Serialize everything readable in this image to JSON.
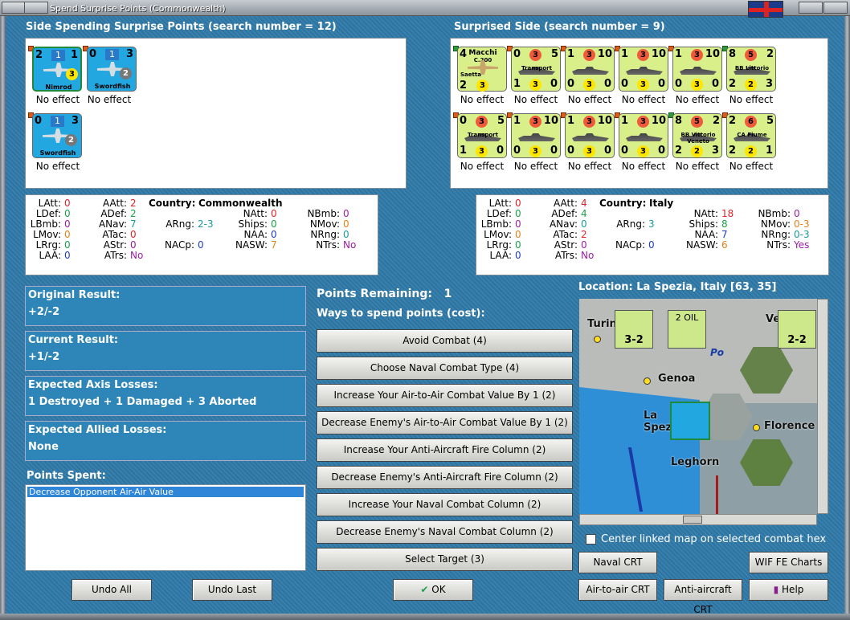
{
  "window": {
    "title": "Spend Surprise Points (Commonwealth)"
  },
  "left_header": "Side Spending Surprise Points (search number = 12)",
  "right_header": "Surprised Side (search number = 9)",
  "left_units": [
    {
      "name": "Nimrod",
      "tl": "2",
      "tr": "1",
      "mid": "1",
      "circ": "3",
      "effect": "No effect"
    },
    {
      "name": "Swordfish",
      "tl": "0",
      "tr": "3",
      "mid": "1",
      "circ": "2",
      "effect": "No effect"
    },
    {
      "name": "Swordfish",
      "tl": "0",
      "tr": "3",
      "mid": "1",
      "circ": "2",
      "effect": "No effect"
    }
  ],
  "right_units": [
    {
      "name": "Macchi",
      "sub": "C.200",
      "sub2": "Saetta",
      "tl": "4",
      "bl": "2",
      "circ": "3",
      "effect": "No effect"
    },
    {
      "name": "Transport",
      "tl": "0",
      "c": "3",
      "tr": "5",
      "bl": "1",
      "bc": "3",
      "br": "0",
      "effect": "No effect"
    },
    {
      "name": "",
      "tl": "1",
      "c": "3",
      "tr": "10",
      "bl": "0",
      "bc": "3",
      "br": "0",
      "effect": "No effect"
    },
    {
      "name": "",
      "tl": "1",
      "c": "3",
      "tr": "10",
      "bl": "0",
      "bc": "3",
      "br": "0",
      "effect": "No effect"
    },
    {
      "name": "",
      "tl": "1",
      "c": "3",
      "tr": "10",
      "bl": "0",
      "bc": "3",
      "br": "0",
      "effect": "No effect"
    },
    {
      "name": "BB Littorio",
      "tl": "8",
      "c": "5",
      "tr": "2",
      "bl": "2",
      "bc": "2",
      "br": "3",
      "effect": "No effect"
    },
    {
      "name": "Transport",
      "tl": "0",
      "c": "3",
      "tr": "5",
      "bl": "1",
      "bc": "3",
      "br": "0",
      "effect": "No effect"
    },
    {
      "name": "",
      "tl": "1",
      "c": "3",
      "tr": "10",
      "bl": "0",
      "bc": "3",
      "br": "0",
      "effect": "No effect"
    },
    {
      "name": "",
      "tl": "1",
      "c": "3",
      "tr": "10",
      "bl": "0",
      "bc": "3",
      "br": "0",
      "effect": "No effect"
    },
    {
      "name": "",
      "tl": "1",
      "c": "3",
      "tr": "10",
      "bl": "0",
      "bc": "3",
      "br": "0",
      "effect": "No effect"
    },
    {
      "name": "BB Vittorio Veneto",
      "tl": "8",
      "c": "5",
      "tr": "2",
      "bl": "2",
      "bc": "2",
      "br": "3",
      "effect": "No effect"
    },
    {
      "name": "CA Fiume",
      "tl": "2",
      "c": "6",
      "tr": "5",
      "bl": "2",
      "bc": "2",
      "br": "1",
      "effect": "No effect"
    }
  ],
  "left_stats": {
    "country_label": "Country:",
    "country": "Commonwealth",
    "LAtt": "0",
    "LDef": "0",
    "LBmb": "0",
    "LMov": "0",
    "LRrg": "0",
    "LAA": "0",
    "AAtt": "2",
    "ADef": "2",
    "ANav": "7",
    "ATac": "0",
    "AStr": "0",
    "ATrs": "No",
    "ARng": "2-3",
    "NACp": "0",
    "NAtt": "0",
    "Ships": "0",
    "NAA": "0",
    "NASW": "7",
    "NBmb": "0",
    "NMov": "0",
    "NRng": "0",
    "NTrs": "No"
  },
  "right_stats": {
    "country_label": "Country:",
    "country": "Italy",
    "LAtt": "0",
    "LDef": "0",
    "LBmb": "0",
    "LMov": "0",
    "LRrg": "0",
    "LAA": "0",
    "AAtt": "4",
    "ADef": "4",
    "ANav": "0",
    "ATac": "2",
    "AStr": "0",
    "ATrs": "No",
    "ARng": "3",
    "NACp": "0",
    "NAtt": "18",
    "Ships": "8",
    "NAA": "7",
    "NASW": "6",
    "NBmb": "0",
    "NMov": "0-3",
    "NRng": "0-3",
    "NTrs": "Yes"
  },
  "results": {
    "original_label": "Original Result:",
    "original": "+2/-2",
    "current_label": "Current Result:",
    "current": "+1/-2",
    "axis_label": "Expected Axis Losses:",
    "axis": "1 Destroyed + 1 Damaged + 3 Aborted",
    "allied_label": "Expected Allied Losses:",
    "allied": "None"
  },
  "points_spent_label": "Points Spent:",
  "points_spent_items": [
    "Decrease Opponent Air-Air Value"
  ],
  "points_remaining_label": "Points Remaining:",
  "points_remaining": "1",
  "ways_label": "Ways to spend points (cost):",
  "options": [
    "Avoid Combat (4)",
    "Choose Naval Combat Type (4)",
    "Increase Your Air-to-Air Combat Value By 1 (2)",
    "Decrease Enemy's Air-to-Air Combat Value By 1 (2)",
    "Increase Your Anti-Aircraft Fire Column (2)",
    "Decrease Enemy's Anti-Aircraft Fire Column (2)",
    "Increase Your Naval Combat Column (2)",
    "Decrease Enemy's Naval Combat Column (2)",
    "Select Target (3)"
  ],
  "location": "Location: La Spezia, Italy [63, 35]",
  "map": {
    "towns": [
      "Turin",
      "Genoa",
      "La Spezia",
      "Florence",
      "Leghorn",
      "Venice"
    ],
    "river": "Po",
    "oil": "2 OIL",
    "corps1": "3-2",
    "corps2": "2-2"
  },
  "center_map_label": "Center linked map on selected combat hex",
  "buttons": {
    "undo_all": "Undo All",
    "undo_last": "Undo Last",
    "ok": "OK",
    "naval_crt": "Naval CRT",
    "wif_charts": "WIF FE Charts",
    "air_crt": "Air-to-air CRT",
    "aa_crt": "Anti-aircraft CRT",
    "help": "Help"
  }
}
